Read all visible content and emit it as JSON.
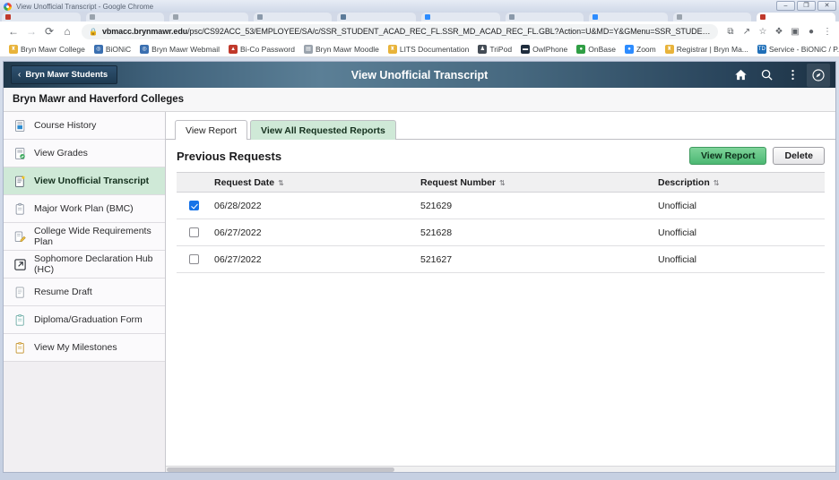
{
  "window": {
    "title": "View Unofficial Transcript - Google Chrome",
    "minimize_label": "–",
    "maximize_label": "❐",
    "close_label": "✕"
  },
  "browser": {
    "back_icon": "←",
    "forward_icon": "→",
    "reload_icon": "⟳",
    "home_icon": "⌂",
    "lock_icon": "ὑ2",
    "url_host": "vbmacc.brynmawr.edu",
    "url_path": "/psc/CS92ACC_53/EMPLOYEE/SA/c/SSR_STUDENT_ACAD_REC_FL.SSR_MD_ACAD_REC_FL.GBL?Action=U&MD=Y&GMenu=SSR_STUDENT_ACAD_REC_...",
    "toolbar_icons": [
      {
        "name": "install-app-icon",
        "glyph": "⧉"
      },
      {
        "name": "share-icon",
        "glyph": "↗"
      },
      {
        "name": "bookmark-star-icon",
        "glyph": "☆"
      },
      {
        "name": "extensions-puzzle-icon",
        "glyph": "❖"
      },
      {
        "name": "side-panel-icon",
        "glyph": "▣"
      },
      {
        "name": "profile-avatar-icon",
        "glyph": "●"
      },
      {
        "name": "chrome-menu-icon",
        "glyph": "⋮"
      }
    ],
    "bookmarks": [
      {
        "label": "Bryn Mawr College",
        "icon": "bryn-mawr-lamp-icon",
        "glyph": "♜",
        "color": "#e8b33a"
      },
      {
        "label": "BiONiC",
        "icon": "globe-icon",
        "glyph": "◎",
        "color": "#3a6fb0"
      },
      {
        "label": "Bryn Mawr Webmail",
        "icon": "globe-icon",
        "glyph": "◎",
        "color": "#3a6fb0"
      },
      {
        "label": "Bi-Co Password",
        "icon": "shield-icon",
        "glyph": "▲",
        "color": "#c0392b"
      },
      {
        "label": "Bryn Mawr Moodle",
        "icon": "moodle-icon",
        "glyph": "▤",
        "color": "#9aa3ad"
      },
      {
        "label": "LITS Documentation",
        "icon": "bryn-mawr-lamp-icon",
        "glyph": "♜",
        "color": "#e8b33a"
      },
      {
        "label": "TriPod",
        "icon": "tripod-icon",
        "glyph": "♟",
        "color": "#444c55"
      },
      {
        "label": "OwlPhone",
        "icon": "owlphone-icon",
        "glyph": "▬",
        "color": "#1f2d3d"
      },
      {
        "label": "OnBase",
        "icon": "onbase-globe-icon",
        "glyph": "●",
        "color": "#2f9e44"
      },
      {
        "label": "Zoom",
        "icon": "zoom-icon",
        "glyph": "●",
        "color": "#2d8cff"
      },
      {
        "label": "Registrar | Bryn Ma...",
        "icon": "bryn-mawr-lamp-icon",
        "glyph": "♜",
        "color": "#e8b33a"
      },
      {
        "label": "Service - BiONiC / P...",
        "icon": "service-icon",
        "glyph": "TD",
        "color": "#1f6fb8"
      }
    ],
    "bookmarks_overflow": "»",
    "tabs": [
      {
        "color": "#c0392b"
      },
      {
        "color": "#9aa3ad"
      },
      {
        "color": "#9aa3ad"
      },
      {
        "color": "#8a99aa"
      },
      {
        "color": "#5b7a99"
      },
      {
        "color": "#2d8cff"
      },
      {
        "color": "#8a99aa"
      },
      {
        "color": "#2d8cff"
      },
      {
        "color": "#9aa3ad"
      },
      {
        "color": "#c0392b",
        "active": true
      }
    ]
  },
  "app": {
    "back_button_label": "Bryn Mawr Students",
    "back_chevron": "‹",
    "page_title": "View Unofficial Transcript",
    "subtitle": "Bryn Mawr and Haverford Colleges",
    "header_actions": [
      {
        "name": "home-icon",
        "label": "Home"
      },
      {
        "name": "search-icon",
        "label": "Search"
      },
      {
        "name": "actions-kebab-icon",
        "label": "Actions"
      },
      {
        "name": "navigator-compass-icon",
        "label": "NavBar"
      }
    ]
  },
  "sidebar": {
    "items": [
      {
        "label": "Course History",
        "icon": "course-history-icon",
        "active": false
      },
      {
        "label": "View Grades",
        "icon": "view-grades-icon",
        "active": false
      },
      {
        "label": "View Unofficial Transcript",
        "icon": "transcript-icon",
        "active": true
      },
      {
        "label": "Major Work Plan (BMC)",
        "icon": "clipboard-icon",
        "active": false
      },
      {
        "label": "College Wide Requirements Plan",
        "icon": "requirements-plan-icon",
        "active": false
      },
      {
        "label": "Sophomore Declaration Hub (HC)",
        "icon": "external-link-icon",
        "active": false
      },
      {
        "label": "Resume Draft",
        "icon": "resume-icon",
        "active": false
      },
      {
        "label": "Diploma/Graduation Form",
        "icon": "diploma-form-icon",
        "active": false
      },
      {
        "label": "View My Milestones",
        "icon": "milestones-clipboard-icon",
        "active": false
      }
    ]
  },
  "main": {
    "tabs": [
      {
        "label": "View Report",
        "active": false
      },
      {
        "label": "View All Requested Reports",
        "active": true
      }
    ],
    "section_title": "Previous Requests",
    "buttons": {
      "view_report": "View Report",
      "delete": "Delete"
    },
    "table": {
      "sort_glyph": "⇅",
      "columns": [
        "",
        "Request Date",
        "Request Number",
        "Description"
      ],
      "rows": [
        {
          "selected": true,
          "date": "06/28/2022",
          "number": "521629",
          "description": "Unofficial"
        },
        {
          "selected": false,
          "date": "06/27/2022",
          "number": "521628",
          "description": "Unofficial"
        },
        {
          "selected": false,
          "date": "06/27/2022",
          "number": "521627",
          "description": "Unofficial"
        }
      ]
    }
  },
  "colors": {
    "accent_green": "#cfe9d7",
    "primary_button": "#4cb873",
    "header_blue": "#3f617a",
    "checkbox_blue": "#1673e8"
  }
}
